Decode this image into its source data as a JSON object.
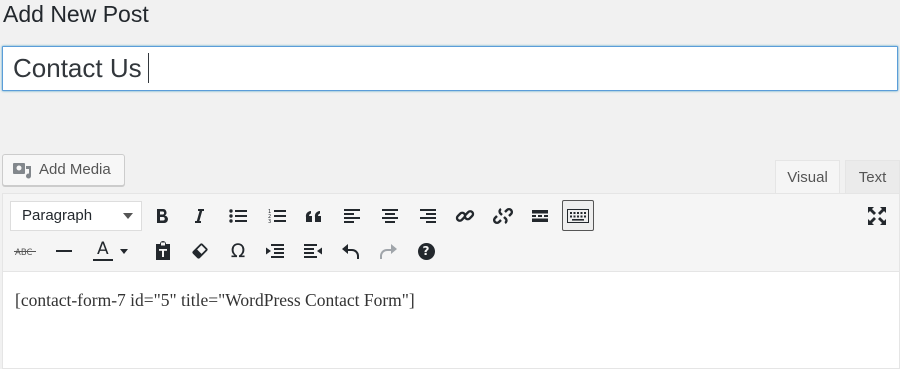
{
  "page": {
    "title": "Add New Post"
  },
  "post": {
    "title_value": "Contact Us"
  },
  "media": {
    "add_media_label": "Add Media"
  },
  "editor_tabs": {
    "visual": "Visual",
    "text": "Text"
  },
  "toolbar": {
    "format_select_value": "Paragraph",
    "row1_icons": [
      "bold-icon",
      "italic-icon",
      "bullet-list-icon",
      "numbered-list-icon",
      "blockquote-icon",
      "align-left-icon",
      "align-center-icon",
      "align-right-icon",
      "link-icon",
      "unlink-icon",
      "read-more-icon",
      "toolbar-toggle-icon",
      "fullscreen-icon"
    ],
    "row2_icons": [
      "strikethrough-icon",
      "horizontal-line-icon",
      "text-color-icon",
      "paste-as-text-icon",
      "clear-formatting-icon",
      "special-character-icon",
      "outdent-icon",
      "indent-icon",
      "undo-icon",
      "redo-icon",
      "help-icon"
    ],
    "strikethrough_label": "ABC",
    "text_color_label": "A",
    "special_char_label": "Ω",
    "help_label": "?"
  },
  "content": {
    "shortcode": "[contact-form-7 id=\"5\" title=\"WordPress Contact Form\"]"
  }
}
